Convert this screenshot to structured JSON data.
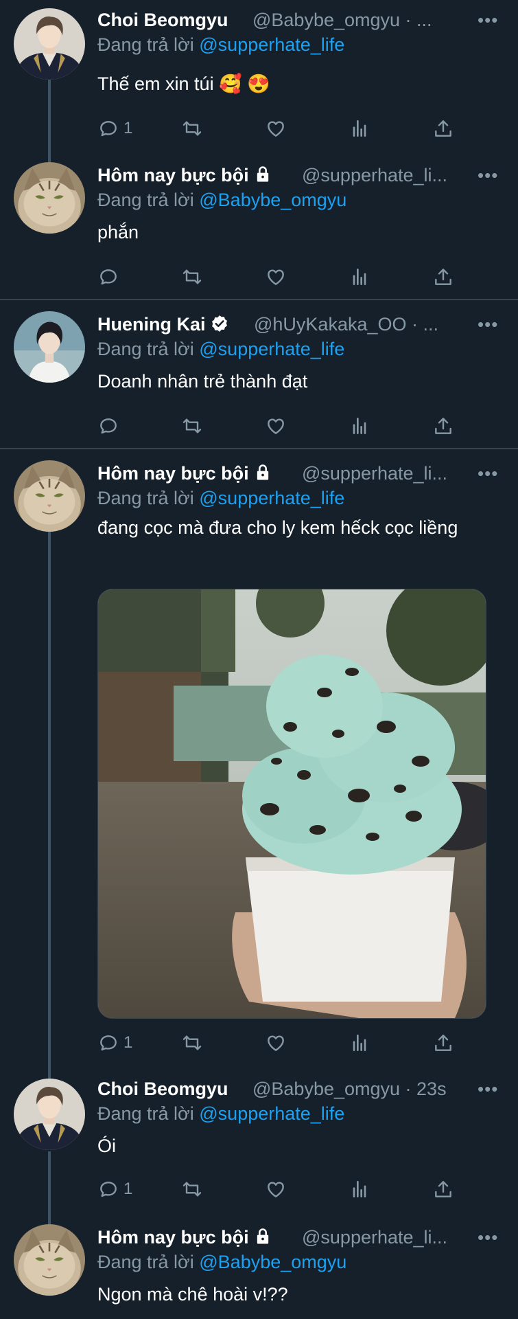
{
  "colors": {
    "background": "#15202b",
    "link": "#1da1f2",
    "secondary": "#8899a6",
    "divider": "#38444d"
  },
  "tweets": [
    {
      "name": "Choi Beomgyu",
      "handle": "@Babybe_omgyu · ...",
      "reply_prefix": "Đang trả lời ",
      "reply_to": "@supperhate_life",
      "text": "Thế em xin túi 🥰 😍",
      "reply_count": "1",
      "avatar": "person-avatar"
    },
    {
      "name": "Hôm nay bực bội",
      "handle": "@supperhate_li...",
      "reply_prefix": "Đang trả lời ",
      "reply_to": "@Babybe_omgyu",
      "text": "phắn",
      "reply_count": "",
      "avatar": "cat-avatar",
      "protected": true
    },
    {
      "name": "Huening Kai",
      "handle": "@hUyKakaka_OO · ...",
      "reply_prefix": "Đang trả lời ",
      "reply_to": "@supperhate_life",
      "text": "Doanh nhân trẻ thành đạt",
      "reply_count": "",
      "avatar": "person-avatar",
      "verified": true
    },
    {
      "name": "Hôm nay bực bội",
      "handle": "@supperhate_li...",
      "reply_prefix": "Đang trả lời ",
      "reply_to": "@supperhate_life",
      "text": "đang cọc mà đưa cho ly kem hếck cọc liềng",
      "reply_count": "1",
      "avatar": "cat-avatar",
      "protected": true,
      "media": "ice-cream-photo"
    },
    {
      "name": "Choi Beomgyu",
      "handle": "@Babybe_omgyu · 23s",
      "reply_prefix": "Đang trả lời ",
      "reply_to": "@supperhate_life",
      "text": "Ói",
      "reply_count": "1",
      "avatar": "person-avatar"
    },
    {
      "name": "Hôm nay bực bội",
      "handle": "@supperhate_li...",
      "reply_prefix": "Đang trả lời ",
      "reply_to": "@Babybe_omgyu",
      "text": "Ngon mà chê hoài v!??",
      "reply_count": "",
      "avatar": "cat-avatar",
      "protected": true
    }
  ],
  "more_label": "•••",
  "icons": [
    "reply-icon",
    "retweet-icon",
    "like-icon",
    "analytics-icon",
    "share-icon",
    "lock-icon",
    "verified-icon"
  ]
}
